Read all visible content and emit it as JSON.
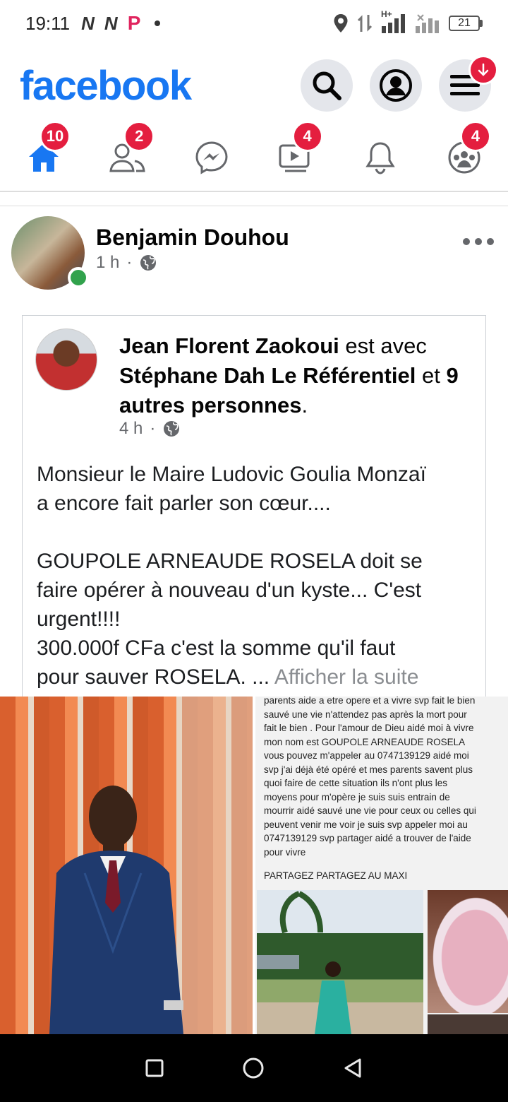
{
  "status_bar": {
    "time": "19:11",
    "left_glyphs": [
      "N",
      "N"
    ],
    "p_glyph": "P",
    "network_label": "H+",
    "battery": "21"
  },
  "header": {
    "logo": "facebook"
  },
  "nav": {
    "tabs": [
      {
        "name": "home",
        "badge": "10",
        "active": true
      },
      {
        "name": "friends",
        "badge": "2"
      },
      {
        "name": "messenger",
        "badge": ""
      },
      {
        "name": "watch",
        "badge": "4"
      },
      {
        "name": "notifications",
        "badge": ""
      },
      {
        "name": "groups",
        "badge": "4"
      }
    ]
  },
  "post": {
    "author": "Benjamin Douhou",
    "time": "1 h",
    "separator": "·",
    "shared": {
      "author": "Jean Florent Zaokoui",
      "with_text": " est avec",
      "tagged": "Stéphane Dah Le Référentiel",
      "and_text": " et ",
      "others_count": "9",
      "others_text": "autres personnes",
      "period": ".",
      "time": "4 h",
      "separator": "·",
      "body_lines": [
        "Monsieur le Maire Ludovic Goulia Monzaï",
        "a encore fait parler son cœur....",
        "",
        "GOUPOLE ARNEAUDE ROSELA  doit se",
        "faire opérer à nouveau d'un kyste... C'est",
        "urgent!!!!",
        "300.000f CFa c'est la somme qu'il faut",
        "pour sauver ROSELA. ... "
      ],
      "see_more": "Afficher la suite"
    },
    "photo_text": "parents aide a etre opere et a vivre svp fait le bien\nsauvé une vie n'attendez pas après la mort pour\nfait le bien . Pour l'amour de Dieu aidé moi à vivre\nmon nom est GOUPOLE ARNEAUDE ROSELA\nvous pouvez m'appeler au 0747139129 aidé moi\nsvp j'ai déjà été opéré et mes parents savent plus\nquoi faire de cette situation ils n'ont plus les\nmoyens pour m'opère je suis suis entrain de\nmourrir aidé sauvé une vie pour ceux ou celles qui\npeuvent venir me voir je suis svp appeler moi au\n0747139129 svp partager aidé a trouver de l'aide\npour vivre",
    "photo_heading": "PARTAGEZ PARTAGEZ AU MAXI"
  }
}
